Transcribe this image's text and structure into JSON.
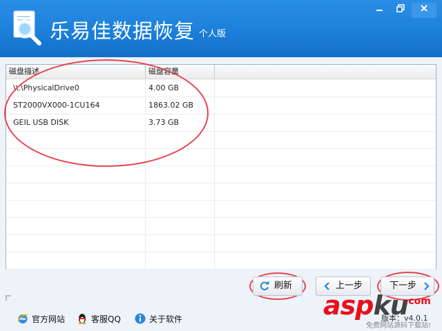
{
  "app": {
    "title": "乐易佳数据恢复",
    "edition": "个人版"
  },
  "window_controls": {
    "minimize_icon": "minimize-icon",
    "maximize_icon": "restore-icon",
    "close_icon": "close-icon"
  },
  "table": {
    "columns": [
      "磁盘描述",
      "磁盘容量"
    ],
    "rows": [
      {
        "description": "\\\\.\\PhysicalDrive0",
        "capacity": "4.00 GB"
      },
      {
        "description": "ST2000VX000-1CU164",
        "capacity": "1863.02 GB"
      },
      {
        "description": "GEIL USB DISK",
        "capacity": "3.73 GB"
      }
    ],
    "empty_rows": 8
  },
  "buttons": {
    "refresh": "刷新",
    "prev": "上一步",
    "next": "下一步"
  },
  "footer": {
    "website": "官方网站",
    "support": "客服QQ",
    "about": "关于软件",
    "version": "版本：v4.0.1"
  },
  "watermark": {
    "main": "asp",
    "main2": "ku",
    "com": ".com",
    "sub": "免费网站源码下载站!"
  },
  "colors": {
    "header": "#1c7fda",
    "highlight_oval": "#e8424e",
    "watermark": "#e8101c"
  }
}
